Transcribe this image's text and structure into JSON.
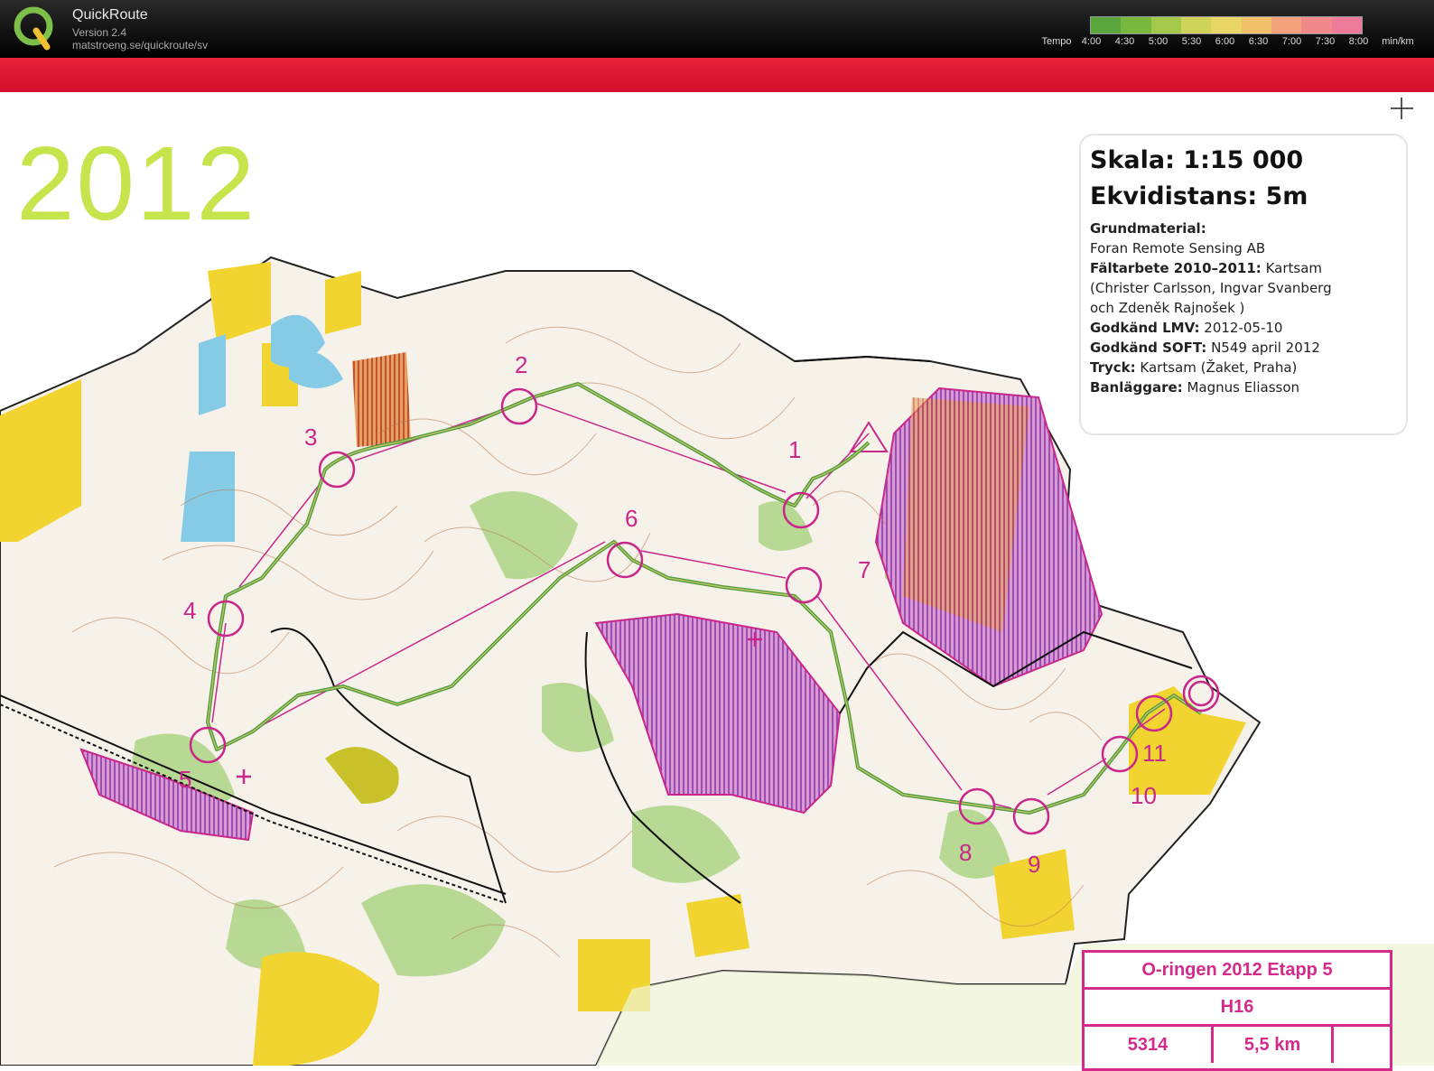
{
  "app": {
    "name": "QuickRoute",
    "version": "Version 2.4",
    "url": "matstroeng.se/quickroute/sv"
  },
  "tempo_scale": {
    "label": "Tempo",
    "ticks": [
      "4:00",
      "4:30",
      "5:00",
      "5:30",
      "6:00",
      "6:30",
      "7:00",
      "7:30",
      "8:00"
    ],
    "unit": "min/km",
    "colors": [
      "#5aa63c",
      "#78b83e",
      "#a4c84a",
      "#cfd35a",
      "#e8d566",
      "#f0c06a",
      "#f3a37a",
      "#f08a8a",
      "#ec7a9a"
    ]
  },
  "map": {
    "year": "2012",
    "legend": {
      "scale": "Skala: 1:15 000",
      "contour": "Ekvidistans: 5m",
      "lines": [
        {
          "label": "Grundmaterial:",
          "value": ""
        },
        {
          "label": "",
          "value": "Foran Remote Sensing AB"
        },
        {
          "label": "Fältarbete 2010–2011:",
          "value": " Kartsam"
        },
        {
          "label": "",
          "value": "(Christer Carlsson, Ingvar Svanberg"
        },
        {
          "label": "",
          "value": "och Zdeněk Rajnošek )"
        },
        {
          "label": "Godkänd LMV:",
          "value": " 2012-05-10"
        },
        {
          "label": "Godkänd SOFT:",
          "value": " N549 april 2012"
        },
        {
          "label": "Tryck:",
          "value": " Kartsam (Žaket, Praha)"
        },
        {
          "label": "Banläggare:",
          "value": " Magnus Eliasson"
        }
      ]
    },
    "event": {
      "title": "O-ringen 2012 Etapp 5",
      "class": "H16",
      "code": "5314",
      "length": "5,5 km"
    },
    "controls": [
      {
        "label": "1"
      },
      {
        "label": "2"
      },
      {
        "label": "3"
      },
      {
        "label": "4"
      },
      {
        "label": "5"
      },
      {
        "label": "6"
      },
      {
        "label": "7"
      },
      {
        "label": "8"
      },
      {
        "label": "9"
      },
      {
        "label": "10"
      },
      {
        "label": "11"
      }
    ],
    "colors": {
      "course": "#c9278a",
      "route": "#4e9a3c",
      "forbidden": "#b03a9a",
      "field": "#f2d431",
      "forest_green": "#9cc974",
      "water": "#7cc7e8"
    }
  }
}
